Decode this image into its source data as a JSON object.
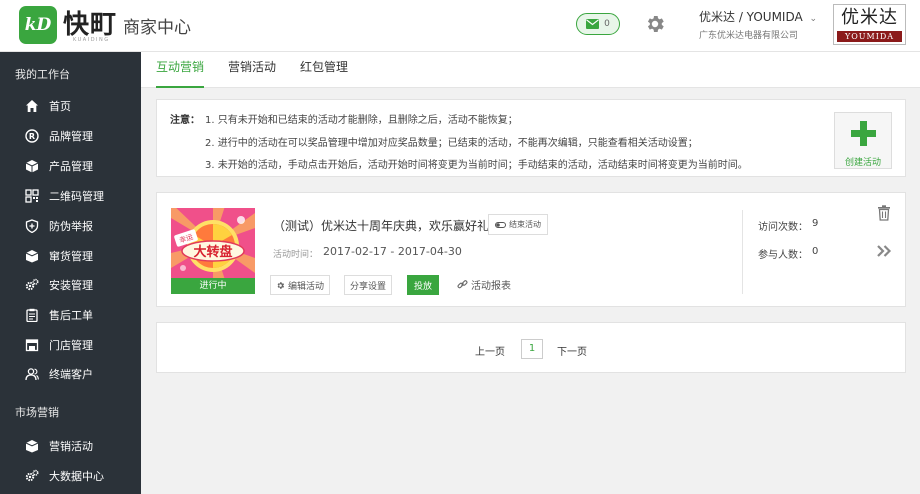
{
  "header": {
    "logo_mark": "kD",
    "logo_text": "快町",
    "logo_sub": "KUAIDING",
    "app_title": "商家中心",
    "message_count": "0",
    "user_name": "优米达 / YOUMIDA",
    "company": "广东优米达电器有限公司",
    "brand_cn": "优米达",
    "brand_en": "YOUMIDA"
  },
  "sidebar": {
    "section1": "我的工作台",
    "items1": [
      {
        "label": "首页",
        "icon": "home-icon"
      },
      {
        "label": "品牌管理",
        "icon": "registered-icon"
      },
      {
        "label": "产品管理",
        "icon": "cube-icon"
      },
      {
        "label": "二维码管理",
        "icon": "qrcode-icon"
      },
      {
        "label": "防伪举报",
        "icon": "shield-icon"
      },
      {
        "label": "窜货管理",
        "icon": "box-icon"
      },
      {
        "label": "安装管理",
        "icon": "gears-icon"
      },
      {
        "label": "售后工单",
        "icon": "clipboard-icon"
      },
      {
        "label": "门店管理",
        "icon": "store-icon"
      },
      {
        "label": "终端客户",
        "icon": "users-icon"
      }
    ],
    "section2": "市场营销",
    "items2": [
      {
        "label": "营销活动",
        "icon": "box-icon"
      },
      {
        "label": "大数据中心",
        "icon": "gears-icon"
      }
    ]
  },
  "tabs": [
    "互动营销",
    "营销活动",
    "红包管理"
  ],
  "notice": {
    "head": "注意：",
    "lines": [
      "1. 只有未开始和已结束的活动才能删除，且删除之后，活动不能恢复；",
      "2. 进行中的活动在可以奖品管理中增加对应奖品数量；已结束的活动，不能再次编辑，只能查看相关活动设置；",
      "3. 未开始的活动，手动点击开始后，活动开始时间将变更为当前时间；手动结束的活动，活动结束时间将变更为当前时间。"
    ],
    "create_label": "创建活动"
  },
  "activity": {
    "thumb_label": "大转盘",
    "thumb_tag": "幸运",
    "status": "进行中",
    "title": "（测试）优米达十周年庆典，欢乐赢好礼",
    "end_label": "结束活动",
    "time_label": "活动时间：",
    "time": "2017-02-17 - 2017-04-30",
    "edit_label": "编辑活动",
    "share_label": "分享设置",
    "publish_label": "投放",
    "report_label": "活动报表",
    "visits_label": "访问次数：",
    "visits": "9",
    "participants_label": "参与人数：",
    "participants": "0"
  },
  "pager": {
    "prev": "上一页",
    "current": "1",
    "next": "下一页"
  },
  "colors": {
    "accent": "#3aa63f",
    "sidebar_bg": "#2b3239"
  }
}
